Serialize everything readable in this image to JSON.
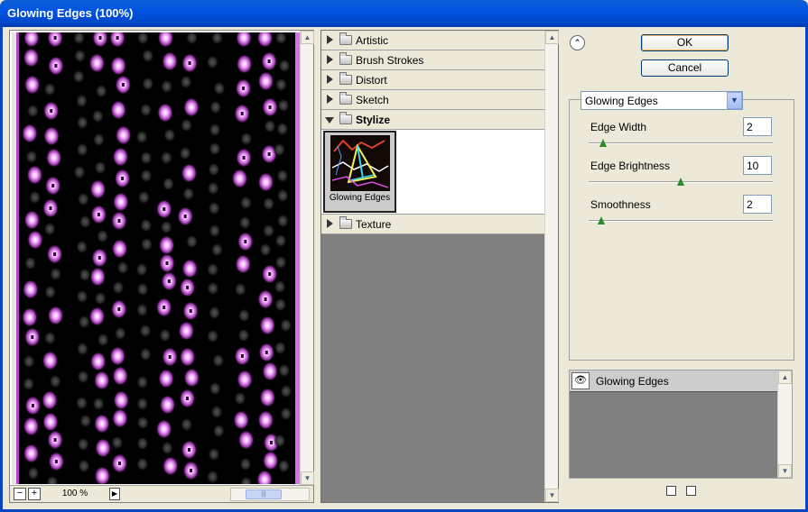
{
  "window": {
    "title": "Glowing Edges (100%)"
  },
  "preview": {
    "zoom": "100 %",
    "minus": "−",
    "plus": "+",
    "play": "▶",
    "scroll_thumb": "|||"
  },
  "tree": {
    "categories": [
      {
        "label": "Artistic"
      },
      {
        "label": "Brush Strokes"
      },
      {
        "label": "Distort"
      },
      {
        "label": "Sketch"
      },
      {
        "label": "Stylize"
      },
      {
        "label": "Texture"
      }
    ],
    "thumbnail_label": "Glowing Edges"
  },
  "buttons": {
    "ok": "OK",
    "cancel": "Cancel",
    "collapse": "⌃"
  },
  "settings": {
    "filter": "Glowing Edges",
    "params": [
      {
        "label": "Edge Width",
        "value": "2",
        "level": 0.08
      },
      {
        "label": "Edge Brightness",
        "value": "10",
        "level": 0.5
      },
      {
        "label": "Smoothness",
        "value": "2",
        "level": 0.07
      }
    ]
  },
  "layers": {
    "items": [
      {
        "name": "Glowing Edges"
      }
    ],
    "eye_icon": "eye-icon"
  },
  "colors": {
    "title_blue": "#0054e3",
    "glow": "#e07af0",
    "glow_green": "#2fd02f"
  }
}
